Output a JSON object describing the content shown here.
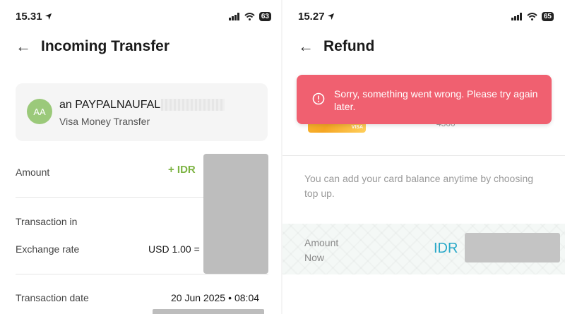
{
  "left": {
    "status": {
      "time": "15.31",
      "battery": "63"
    },
    "title": "Incoming Transfer",
    "sender": {
      "initials": "AA",
      "name": "an PAYPALNAUFAL",
      "subtitle": "Visa Money Transfer"
    },
    "rows": {
      "amount_label": "Amount",
      "amount_value": "+ IDR ",
      "transaction_in_label": "Transaction in",
      "exchange_rate_label": "Exchange rate",
      "exchange_rate_value": "USD 1.00 =",
      "date_label": "Transaction date",
      "date_value": "20 Jun 2025",
      "time_value": "08:04"
    }
  },
  "right": {
    "status": {
      "time": "15.27",
      "battery": "65"
    },
    "title": "Refund",
    "card": {
      "brand": "VISA",
      "number_fragment": "4300"
    },
    "toast": {
      "message": "Sorry, something went wrong. Please try again later."
    },
    "hint": "You can add your card balance anytime by choosing top up.",
    "amount": {
      "label": "Amount Now",
      "currency": "IDR"
    }
  },
  "colors": {
    "toast": "#f06070",
    "amount_green": "#7cb342",
    "currency_blue": "#28a8c8",
    "avatar": "#9bc97a"
  }
}
